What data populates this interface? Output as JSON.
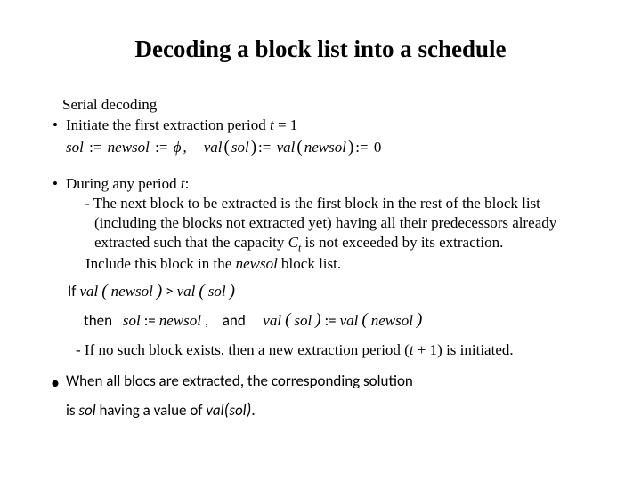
{
  "title": "Decoding a block list into a schedule",
  "subhead": "Serial decoding",
  "bullet1": "Initiate the first extraction period ",
  "bullet1_tail": " = 1",
  "formula1": {
    "a": "sol",
    "b": "newsol",
    "empty": "ϕ",
    "c": "val",
    "d": "sol",
    "e": "val",
    "f": "newsol",
    "zero": "0"
  },
  "bullet2_lead": "During any period ",
  "bullet2_t": "t",
  "bullet2_colon": ":",
  "dash1_a": "- The next block to be extracted is the first block in the rest of the block list (including the blocks not extracted yet) having all their predecessors already extracted such that the capacity ",
  "dash1_c": "C",
  "dash1_t": "t",
  "dash1_b": " is not exceeded by its extraction.",
  "include_a": "Include this block in the ",
  "include_newsol": "newsol",
  "include_b": " block list.",
  "if": {
    "if": "If ",
    "val": "val",
    "newsol": "newsol",
    "gt": ">",
    "sol": "sol"
  },
  "then": {
    "then": "then",
    "sol": "sol",
    "assign": ":=",
    "newsol": "newsol",
    "and": "and",
    "val": "val"
  },
  "dash2_a": "- If no such block exists, then a new extraction period (",
  "dash2_t": "t",
  "dash2_b": " + 1) is initiated.",
  "final1": "When all blocs are extracted, the corresponding solution",
  "final2_a": "is ",
  "final2_sol": "sol",
  "final2_b": " having a value of ",
  "final2_val": "val",
  "final2_sol2": "sol",
  "final2_c": "."
}
